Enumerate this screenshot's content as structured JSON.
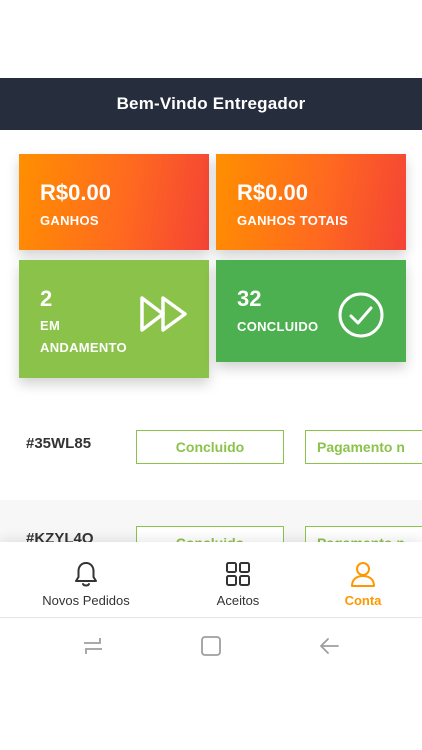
{
  "header": {
    "title": "Bem-Vindo Entregador"
  },
  "stats": {
    "earnings": {
      "amount": "R$0.00",
      "label": "GANHOS"
    },
    "total_earnings": {
      "amount": "R$0.00",
      "label": "GANHOS TOTAIS"
    },
    "in_progress": {
      "count": "2",
      "label_line1": "EM",
      "label_line2": "ANDAMENTO",
      "icon": "fast-forward-icon"
    },
    "completed": {
      "count": "32",
      "label": "CONCLUIDO",
      "icon": "check-circle-icon"
    }
  },
  "orders": [
    {
      "id": "#35WL85",
      "status": "Concluido",
      "payment": "Pagamento n"
    },
    {
      "id": "#KZYL4Q",
      "status": "Concluido",
      "payment": "Pagamento n"
    }
  ],
  "bottom_nav": {
    "items": [
      {
        "label": "Novos Pedidos",
        "icon": "bell-icon"
      },
      {
        "label": "Aceitos",
        "icon": "grid-icon"
      },
      {
        "label": "Conta",
        "icon": "user-icon",
        "active": true
      }
    ]
  },
  "colors": {
    "header_bg": "#262d3d",
    "gradient_start": "#ff8f00",
    "gradient_end": "#f44336",
    "in_progress_bg": "#8bc34a",
    "completed_bg": "#4caf50",
    "accent": "#ff9800"
  }
}
